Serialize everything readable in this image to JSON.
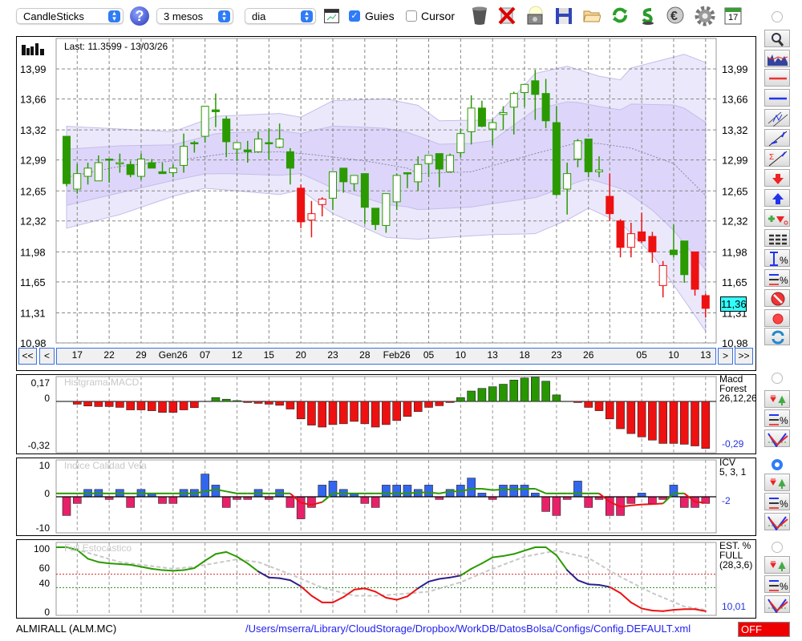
{
  "toolbar": {
    "chart_type": "CandleSticks",
    "period": "3 mesos",
    "interval": "dia",
    "guides_label": "Guies",
    "guides_checked": true,
    "cursor_label": "Cursor",
    "cursor_checked": false,
    "help_glyph": "?",
    "icons": [
      "chart-window-icon",
      "trash-icon",
      "delete-x-icon",
      "camera-icon",
      "save-icon",
      "folder-icon",
      "refresh-icon",
      "sync-icon",
      "euro-icon",
      "gear-icon",
      "calendar-icon"
    ],
    "calendar_day": "17"
  },
  "main": {
    "last_label": "Last: 11.3599 - 13/03/26",
    "price_ticks": [
      "13,99",
      "13,66",
      "13,32",
      "12,99",
      "12,65",
      "12,32",
      "11,98",
      "11,65",
      "11,31",
      "10,98"
    ],
    "current_price": "11,36",
    "current_price_value": 11.36,
    "side_buttons": [
      "magnifier-icon",
      "volume-chart-icon",
      "red-line-icon",
      "blue-line-icon",
      "channel-icon",
      "parallel-trendline-icon",
      "sum-trendline-icon",
      "sell-arrow-icon",
      "buy-arrow-icon",
      "add-order-icon",
      "list-icon",
      "range-percent-icon",
      "lines-percent-icon",
      "no-entry-icon",
      "record-icon",
      "refresh-icon"
    ]
  },
  "nav": {
    "first": "<<",
    "prev": "<",
    "next": ">",
    "last": ">>",
    "date_labels": [
      {
        "i": 1,
        "t": "17"
      },
      {
        "i": 4,
        "t": "22"
      },
      {
        "i": 7,
        "t": "29"
      },
      {
        "i": 10,
        "t": "Gen26"
      },
      {
        "i": 13,
        "t": "07"
      },
      {
        "i": 16,
        "t": "12"
      },
      {
        "i": 19,
        "t": "15"
      },
      {
        "i": 22,
        "t": "20"
      },
      {
        "i": 25,
        "t": "23"
      },
      {
        "i": 28,
        "t": "28"
      },
      {
        "i": 31,
        "t": "Feb26"
      },
      {
        "i": 34,
        "t": "05"
      },
      {
        "i": 37,
        "t": "10"
      },
      {
        "i": 40,
        "t": "13"
      },
      {
        "i": 43,
        "t": "18"
      },
      {
        "i": 46,
        "t": "23"
      },
      {
        "i": 49,
        "t": "26"
      },
      {
        "i": 54,
        "t": "05"
      },
      {
        "i": 57,
        "t": "10"
      },
      {
        "i": 60,
        "t": "13"
      }
    ],
    "grid_indices": [
      1,
      4,
      7,
      10,
      13,
      16,
      19,
      22,
      25,
      28,
      31,
      34,
      37,
      40,
      43,
      46,
      49,
      51,
      54,
      57,
      60
    ]
  },
  "macd": {
    "title": "Histgrama MACD",
    "legend": [
      "Macd",
      "Forest",
      "26,12,26"
    ],
    "ticks": [
      {
        "v": 0.17,
        "t": "0,17"
      },
      {
        "v": 0,
        "t": "0"
      },
      {
        "v": -0.32,
        "t": "-0,32"
      }
    ],
    "current": "-0,29"
  },
  "icv": {
    "title": "Indice Calidad Vela",
    "legend": [
      "ICV",
      "5, 3, 1"
    ],
    "ticks": [
      {
        "v": 10,
        "t": "10"
      },
      {
        "v": 0,
        "t": "0"
      },
      {
        "v": -10,
        "t": "-10"
      }
    ],
    "current": "-2"
  },
  "stoch": {
    "title": "Full Estocastico",
    "legend": [
      "EST. %",
      "FULL",
      "(28,3,6)"
    ],
    "ticks": [
      {
        "v": 100,
        "t": "100"
      },
      {
        "v": 60,
        "t": "60"
      },
      {
        "v": 40,
        "t": "40"
      },
      {
        "v": 0,
        "t": "0"
      }
    ],
    "current": "10,01"
  },
  "footer": {
    "symbol": "ALMIRALL (ALM.MC)",
    "path": "/Users/mserra/Library/CloudStorage/Dropbox/WorkDB/DatosBolsa/Configs/Config.DEFAULT.xml",
    "status": "OFF"
  },
  "colors": {
    "up": "#2a9a00",
    "down": "#ee1111",
    "band_outer": "#ebe8fc",
    "band_inner": "#ddd6fa",
    "band_line": "#c4bde9",
    "accent": "#2f7cf6",
    "price_box": "#33ffff",
    "navy": "#2c1f8a"
  },
  "chart_data": [
    {
      "type": "candlestick",
      "title": "Last: 11.3599 - 13/03/26",
      "ylim": [
        10.98,
        13.99
      ],
      "ohlc": [
        [
          13.25,
          13.25,
          12.7,
          12.73,
          "G"
        ],
        [
          12.67,
          12.95,
          12.62,
          12.84,
          "G"
        ],
        [
          12.81,
          12.96,
          12.72,
          12.9,
          "G"
        ],
        [
          12.76,
          13.04,
          12.76,
          12.96,
          "G"
        ],
        [
          13.0,
          13.0,
          12.74,
          12.99,
          "G"
        ],
        [
          12.95,
          13.06,
          12.85,
          12.96,
          "G"
        ],
        [
          12.94,
          12.98,
          12.8,
          12.83,
          "G"
        ],
        [
          12.81,
          13.06,
          12.77,
          13.0,
          "G"
        ],
        [
          12.96,
          13.0,
          12.9,
          12.9,
          "G"
        ],
        [
          12.86,
          12.96,
          12.84,
          12.84,
          "G"
        ],
        [
          12.85,
          12.94,
          12.8,
          12.9,
          "G"
        ],
        [
          12.93,
          13.28,
          12.85,
          13.14,
          "G"
        ],
        [
          13.18,
          13.2,
          13.07,
          13.17,
          "G"
        ],
        [
          13.25,
          13.58,
          13.18,
          13.58,
          "G"
        ],
        [
          13.54,
          13.72,
          13.35,
          13.52,
          "G"
        ],
        [
          13.44,
          13.47,
          13.02,
          13.19,
          "G"
        ],
        [
          13.11,
          13.18,
          12.98,
          13.18,
          "G"
        ],
        [
          13.1,
          13.2,
          12.96,
          13.08,
          "G"
        ],
        [
          13.08,
          13.3,
          13.07,
          13.22,
          "G"
        ],
        [
          13.18,
          13.34,
          12.99,
          13.17,
          "G"
        ],
        [
          13.13,
          13.39,
          13.12,
          13.22,
          "G"
        ],
        [
          13.08,
          13.12,
          12.72,
          12.9,
          "G"
        ],
        [
          12.68,
          12.72,
          12.24,
          12.31,
          "R"
        ],
        [
          12.33,
          12.54,
          12.14,
          12.4,
          "R"
        ],
        [
          12.5,
          12.58,
          12.37,
          12.56,
          "R"
        ],
        [
          12.57,
          12.86,
          12.44,
          12.86,
          "G"
        ],
        [
          12.9,
          12.9,
          12.63,
          12.75,
          "G"
        ],
        [
          12.73,
          12.82,
          12.65,
          12.82,
          "G"
        ],
        [
          12.84,
          12.84,
          12.29,
          12.47,
          "G"
        ],
        [
          12.46,
          12.46,
          12.22,
          12.28,
          "G"
        ],
        [
          12.27,
          12.62,
          12.19,
          12.62,
          "G"
        ],
        [
          12.53,
          12.84,
          12.44,
          12.82,
          "G"
        ],
        [
          12.85,
          12.85,
          12.68,
          12.84,
          "G"
        ],
        [
          12.75,
          13.03,
          12.65,
          12.94,
          "G"
        ],
        [
          12.95,
          13.04,
          12.8,
          13.04,
          "G"
        ],
        [
          13.06,
          13.06,
          12.69,
          12.89,
          "G"
        ],
        [
          12.86,
          13.06,
          12.85,
          13.04,
          "G"
        ],
        [
          13.07,
          13.33,
          13.02,
          13.28,
          "G"
        ],
        [
          13.3,
          13.7,
          13.16,
          13.56,
          "G"
        ],
        [
          13.56,
          13.64,
          13.35,
          13.36,
          "G"
        ],
        [
          13.33,
          13.44,
          13.15,
          13.4,
          "G"
        ],
        [
          13.49,
          13.58,
          13.32,
          13.51,
          "G"
        ],
        [
          13.57,
          13.74,
          13.27,
          13.72,
          "G"
        ],
        [
          13.73,
          13.82,
          13.57,
          13.82,
          "G"
        ],
        [
          13.86,
          13.98,
          13.43,
          13.71,
          "G"
        ],
        [
          13.72,
          13.88,
          13.34,
          13.42,
          "G"
        ],
        [
          13.4,
          13.58,
          12.6,
          12.61,
          "G"
        ],
        [
          12.67,
          12.96,
          12.39,
          12.84,
          "G"
        ],
        [
          13.0,
          13.22,
          12.91,
          13.2,
          "G"
        ],
        [
          13.22,
          13.22,
          12.8,
          12.86,
          "G"
        ],
        [
          12.86,
          13.03,
          12.8,
          12.88,
          "G"
        ],
        [
          12.59,
          12.84,
          12.32,
          12.4,
          "R"
        ],
        [
          12.32,
          12.34,
          11.92,
          12.03,
          "R"
        ],
        [
          12.03,
          12.3,
          11.92,
          12.18,
          "R"
        ],
        [
          12.2,
          12.41,
          12.08,
          12.1,
          "R"
        ],
        [
          12.15,
          12.2,
          11.86,
          11.98,
          "R"
        ],
        [
          11.61,
          11.88,
          11.48,
          11.83,
          "R"
        ],
        [
          12.0,
          12.28,
          11.92,
          11.95,
          "G"
        ],
        [
          12.1,
          12.1,
          11.64,
          11.73,
          "G"
        ],
        [
          11.98,
          11.98,
          11.5,
          11.57,
          "R"
        ],
        [
          11.5,
          11.52,
          11.26,
          11.36,
          "R"
        ]
      ],
      "band_upper": [
        [
          0,
          13.36
        ],
        [
          5,
          13.33
        ],
        [
          10,
          13.3
        ],
        [
          14,
          13.47
        ],
        [
          20,
          13.5
        ],
        [
          22,
          13.46
        ],
        [
          25,
          13.64
        ],
        [
          30,
          13.66
        ],
        [
          33,
          13.59
        ],
        [
          35,
          13.42
        ],
        [
          40,
          13.43
        ],
        [
          44,
          13.94
        ],
        [
          47,
          14.02
        ],
        [
          50,
          13.91
        ],
        [
          52,
          13.87
        ],
        [
          53,
          14.0
        ],
        [
          58,
          14.15
        ],
        [
          60,
          14.06
        ]
      ],
      "band_lower": [
        [
          0,
          12.24
        ],
        [
          5,
          12.39
        ],
        [
          10,
          12.59
        ],
        [
          13,
          12.68
        ],
        [
          20,
          12.61
        ],
        [
          22,
          12.66
        ],
        [
          25,
          12.4
        ],
        [
          30,
          12.14
        ],
        [
          33,
          12.12
        ],
        [
          40,
          12.17
        ],
        [
          44,
          12.18
        ],
        [
          47,
          12.33
        ],
        [
          49,
          12.46
        ],
        [
          52,
          12.3
        ],
        [
          55,
          11.95
        ],
        [
          58,
          11.45
        ],
        [
          60,
          11.11
        ]
      ],
      "band_mid": [
        [
          0,
          12.8
        ],
        [
          5,
          12.92
        ],
        [
          10,
          12.98
        ],
        [
          15,
          13.06
        ],
        [
          20,
          13.08
        ],
        [
          23,
          13.05
        ],
        [
          28,
          12.98
        ],
        [
          32,
          12.9
        ],
        [
          33,
          12.84
        ],
        [
          38,
          12.86
        ],
        [
          44,
          13.06
        ],
        [
          48,
          13.18
        ],
        [
          50,
          13.17
        ],
        [
          53,
          13.12
        ],
        [
          57,
          12.95
        ],
        [
          60,
          12.6
        ]
      ],
      "inner_band_ratio": 0.55
    },
    {
      "type": "bar",
      "title": "Histgrama MACD",
      "ylim": [
        -0.34,
        0.19
      ],
      "values": [
        0,
        -0.02,
        -0.033,
        -0.037,
        -0.037,
        -0.043,
        -0.061,
        -0.061,
        -0.067,
        -0.079,
        -0.079,
        -0.061,
        -0.045,
        0,
        0.028,
        0.016,
        0.006,
        -0.008,
        -0.014,
        -0.02,
        -0.028,
        -0.055,
        -0.126,
        -0.171,
        -0.185,
        -0.167,
        -0.161,
        -0.144,
        -0.161,
        -0.185,
        -0.167,
        -0.138,
        -0.108,
        -0.073,
        -0.043,
        -0.031,
        -0.008,
        0.028,
        0.075,
        0.094,
        0.106,
        0.124,
        0.154,
        0.169,
        0.175,
        0.146,
        0.047,
        0,
        -0.008,
        -0.043,
        -0.067,
        -0.126,
        -0.197,
        -0.232,
        -0.256,
        -0.279,
        -0.303,
        -0.303,
        -0.309,
        -0.321,
        -0.339
      ]
    },
    {
      "type": "bar",
      "title": "Indice Calidad Vela",
      "ylim": [
        -10,
        10
      ],
      "values": [
        -5.6,
        -2,
        2.2,
        2.2,
        -0.8,
        2.2,
        -3.2,
        2.2,
        0.8,
        -2,
        -2,
        2.2,
        2.2,
        6.8,
        3.5,
        -3.2,
        -0.8,
        -0.8,
        2.2,
        -0.8,
        2.2,
        -3.2,
        -6.6,
        -3.2,
        3.5,
        4.7,
        2.2,
        0.8,
        -2,
        -3.2,
        3.5,
        3.5,
        3.5,
        2.2,
        3.5,
        -0.8,
        2.2,
        3.5,
        5.6,
        1.1,
        -0.8,
        3.5,
        3.5,
        3.5,
        1.1,
        -4.4,
        -5.6,
        -0.8,
        4.7,
        -3.2,
        -0.8,
        -5.6,
        -5.6,
        -2,
        1.1,
        -2,
        -0.8,
        3.5,
        -3.2,
        -3.2,
        -2
      ],
      "line": [
        1,
        1,
        1,
        1,
        1,
        1,
        1,
        1,
        1,
        1,
        1,
        1,
        1,
        1.6,
        2.2,
        1.6,
        1,
        1,
        1,
        1,
        1,
        1,
        -1.8,
        -2.4,
        -1.6,
        1,
        1,
        1,
        1,
        1,
        1,
        1,
        1,
        1.3,
        1.3,
        1,
        1.6,
        1.6,
        2.4,
        2.4,
        2,
        2.2,
        2.2,
        2.4,
        2.4,
        1,
        1,
        1,
        1,
        1,
        1,
        -1.5,
        -3,
        -2.6,
        -2.3,
        -2.2,
        -2,
        1,
        1,
        -1.5,
        -1.8
      ]
    },
    {
      "type": "line",
      "title": "Full Estocastico",
      "ylim": [
        0,
        100
      ],
      "levels": [
        60,
        40
      ],
      "k": [
        100,
        96,
        83,
        78,
        76,
        75,
        74,
        71,
        68,
        66,
        65,
        66,
        69,
        80,
        90,
        93,
        86,
        76,
        64,
        55,
        54,
        51,
        42,
        28,
        18,
        18,
        26,
        37,
        39,
        34,
        25,
        22,
        27,
        39,
        49,
        53,
        55,
        58,
        68,
        76,
        85,
        87,
        90,
        95,
        100,
        100,
        88,
        66,
        51,
        45,
        44,
        41,
        32,
        18,
        9,
        6,
        5,
        7,
        8,
        8,
        5
      ],
      "signal": [
        [
          0,
          101
        ],
        [
          5,
          78
        ],
        [
          10,
          68
        ],
        [
          12,
          71
        ],
        [
          16,
          82
        ],
        [
          18,
          78
        ],
        [
          21,
          60
        ],
        [
          24,
          40
        ],
        [
          27,
          28
        ],
        [
          29,
          28
        ],
        [
          31,
          30
        ],
        [
          34,
          34
        ],
        [
          37,
          48
        ],
        [
          40,
          68
        ],
        [
          43,
          86
        ],
        [
          46,
          95
        ],
        [
          49,
          84
        ],
        [
          52,
          56
        ],
        [
          55,
          32
        ],
        [
          58,
          12
        ],
        [
          60,
          7
        ]
      ]
    }
  ]
}
